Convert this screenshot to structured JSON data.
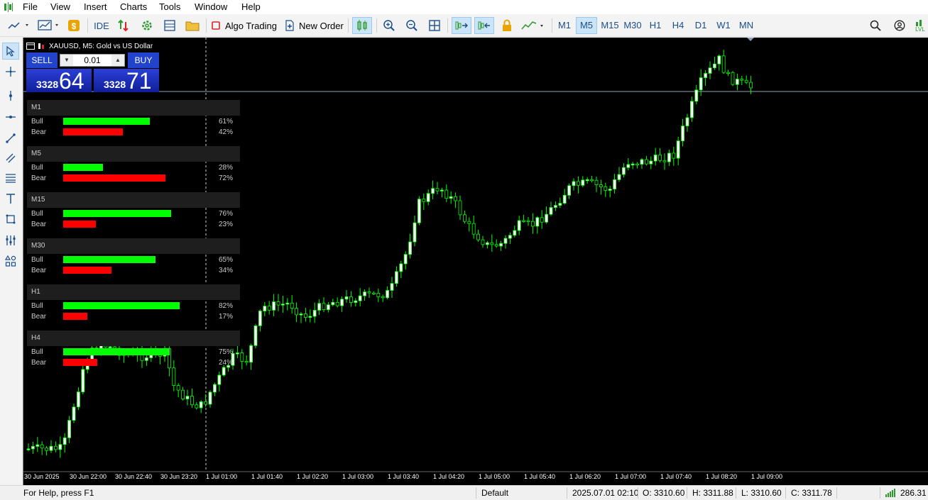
{
  "menu": [
    "File",
    "View",
    "Insert",
    "Charts",
    "Tools",
    "Window",
    "Help"
  ],
  "toolbar": {
    "ide_label": "IDE",
    "algo_trading_label": "Algo Trading",
    "new_order_label": "New Order",
    "timeframes": [
      "M1",
      "M5",
      "M15",
      "M30",
      "H1",
      "H4",
      "D1",
      "W1",
      "MN"
    ],
    "active_timeframe": "M5",
    "lvl_label": "LVL"
  },
  "chart": {
    "title": "XAUUSD, M5:  Gold vs US Dollar",
    "sell_label": "SELL",
    "buy_label": "BUY",
    "lot": "0.01",
    "sell_price_prefix": "3328",
    "sell_price_big": "64",
    "buy_price_prefix": "3328",
    "buy_price_big": "71",
    "colors": {
      "bull": "#00ff00",
      "bear": "#ff0000",
      "candle_up": "#ffffff",
      "wick": "#00ff00",
      "trade_blue": "#2244cc"
    },
    "time_labels": [
      "30 Jun 2025",
      "30 Jun 22:00",
      "30 Jun 22:40",
      "30 Jun 23:20",
      "1 Jul 01:00",
      "1 Jul 01:40",
      "1 Jul 02:20",
      "1 Jul 03:00",
      "1 Jul 03:40",
      "1 Jul 04:20",
      "1 Jul 05:00",
      "1 Jul 05:40",
      "1 Jul 06:20",
      "1 Jul 07:00",
      "1 Jul 07:40",
      "1 Jul 08:20",
      "1 Jul 09:00"
    ]
  },
  "strength": [
    {
      "tf": "M1",
      "bull": 61,
      "bear": 42,
      "bull_label": "Bull",
      "bear_label": "Bear",
      "bull_text": "61%",
      "bear_text": "42%"
    },
    {
      "tf": "M5",
      "bull": 28,
      "bear": 72,
      "bull_label": "Bull",
      "bear_label": "Bear",
      "bull_text": "28%",
      "bear_text": "72%"
    },
    {
      "tf": "M15",
      "bull": 76,
      "bear": 23,
      "bull_label": "Bull",
      "bear_label": "Bear",
      "bull_text": "76%",
      "bear_text": "23%"
    },
    {
      "tf": "M30",
      "bull": 65,
      "bear": 34,
      "bull_label": "Bull",
      "bear_label": "Bear",
      "bull_text": "65%",
      "bear_text": "34%"
    },
    {
      "tf": "H1",
      "bull": 82,
      "bear": 17,
      "bull_label": "Bull",
      "bear_label": "Bear",
      "bull_text": "82%",
      "bear_text": "17%"
    },
    {
      "tf": "H4",
      "bull": 75,
      "bear": 24,
      "bull_label": "Bull",
      "bear_label": "Bear",
      "bull_text": "75%",
      "bear_text": "24%"
    }
  ],
  "status": {
    "help": "For Help, press F1",
    "profile": "Default",
    "datetime": "2025.07.01 02:10",
    "open": "O: 3310.60",
    "high": "H: 3311.88",
    "low": "L: 3310.60",
    "close": "C: 3311.78",
    "ping": "286.31"
  }
}
